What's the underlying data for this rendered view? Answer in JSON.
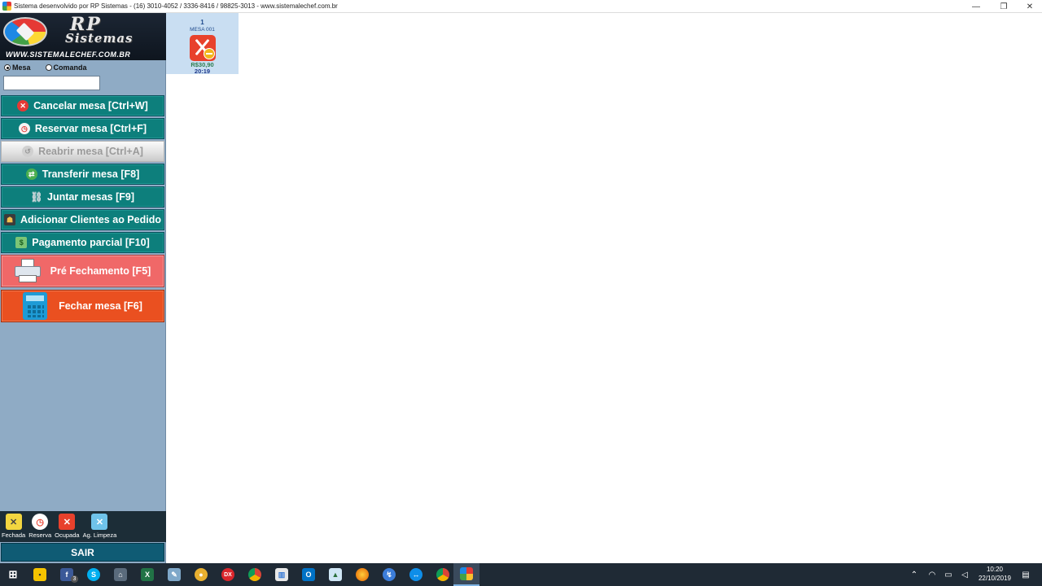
{
  "window": {
    "title": "Sistema desenvolvido por RP Sistemas - (16) 3010-4052 / 3336-8416 / 98825-3013 - www.sistemalechef.com.br",
    "controls": {
      "minimize": "—",
      "restore": "❐",
      "close": "✕"
    }
  },
  "logo": {
    "line1": "RP",
    "line2": "Sistemas",
    "site": "WWW.SISTEMALECHEF.COM.BR"
  },
  "mode": {
    "options": [
      "Mesa",
      "Comanda"
    ],
    "selected": "Mesa"
  },
  "search": {
    "value": ""
  },
  "actions": [
    {
      "label": "Cancelar mesa [Ctrl+W]",
      "icon": "cancel-icon",
      "enabled": true
    },
    {
      "label": "Reservar mesa [Ctrl+F]",
      "icon": "reserve-icon",
      "enabled": true
    },
    {
      "label": "Reabrir mesa [Ctrl+A]",
      "icon": "reopen-icon",
      "enabled": false
    },
    {
      "label": "Transferir mesa [F8]",
      "icon": "transfer-icon",
      "enabled": true
    },
    {
      "label": "Juntar mesas [F9]",
      "icon": "link-icon",
      "enabled": true
    },
    {
      "label": "Adicionar Clientes ao Pedido",
      "icon": "customers-icon",
      "enabled": true
    },
    {
      "label": "Pagamento parcial [F10]",
      "icon": "money-icon",
      "enabled": true
    }
  ],
  "pre_fechamento": {
    "label": "Pré Fechamento [F5]",
    "icon": "printer-icon"
  },
  "fechar": {
    "label": "Fechar mesa [F6]",
    "icon": "calculator-icon"
  },
  "legend": [
    {
      "label": "Fechada",
      "icon": "closed-table-icon",
      "color": "#f2d640"
    },
    {
      "label": "Reserva",
      "icon": "reservation-icon",
      "color": "#e84a3a"
    },
    {
      "label": "Ocupada",
      "icon": "occupied-icon",
      "color": "#e8412c"
    },
    {
      "label": "Ag. Limpeza",
      "icon": "cleaning-icon",
      "color": "#6fc3ea"
    }
  ],
  "exit": {
    "label": "SAIR"
  },
  "tables": [
    {
      "number": "1",
      "name": "MESA 001",
      "status": "Ocupada",
      "amount": "R$30,90",
      "time": "20:19"
    }
  ],
  "taskbar": {
    "apps": [
      "start-icon",
      "sticky-notes-icon",
      "facebook-icon",
      "skype-icon",
      "network-icon",
      "excel-icon",
      "notes-icon",
      "app-icon",
      "dx-icon",
      "chrome-icon",
      "chart-icon",
      "outlook-icon",
      "photos-icon",
      "firefox-icon",
      "remote-icon",
      "teamviewer-icon",
      "chrome-icon-2",
      "restaurant-app-icon"
    ],
    "badge": "3",
    "clock_time": "10:20",
    "clock_date": "22/10/2019"
  }
}
